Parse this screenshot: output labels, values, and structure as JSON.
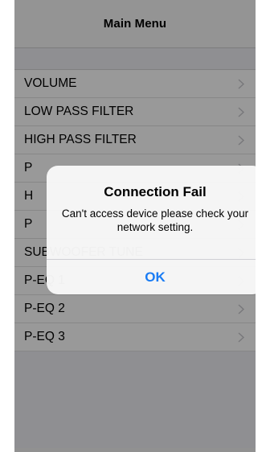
{
  "navbar": {
    "title": "Main Menu"
  },
  "menu": {
    "items": [
      {
        "label": "VOLUME"
      },
      {
        "label": "LOW PASS FILTER"
      },
      {
        "label": "HIGH PASS FILTER"
      },
      {
        "label": "P"
      },
      {
        "label": "H"
      },
      {
        "label": "P"
      },
      {
        "label": "SUBWOOFER TUNE"
      },
      {
        "label": "P-EQ 1"
      },
      {
        "label": "P-EQ 2"
      },
      {
        "label": "P-EQ 3"
      }
    ]
  },
  "alert": {
    "title": "Connection Fail",
    "message": "Can't access device please check your network setting.",
    "button_label": "OK"
  },
  "colors": {
    "accent": "#1a7cf4",
    "chevron": "#c7c7cc"
  }
}
